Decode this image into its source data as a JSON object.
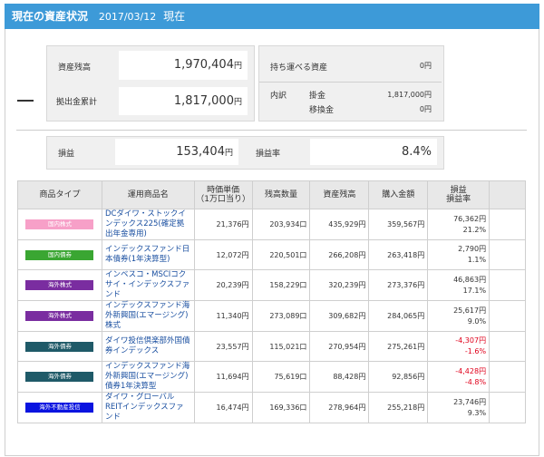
{
  "header": {
    "title": "現在の資産状況",
    "date": "2017/03/12",
    "now": "現在"
  },
  "summary": {
    "asset_label": "資産残高",
    "asset_value": "1,970,404",
    "yen": "円",
    "contrib_label": "拠出金累計",
    "contrib_value": "1,817,000",
    "portable_label": "持ち運べる資産",
    "portable_value": "0円",
    "breakdown_label": "内訳",
    "kakekin_label": "掛金",
    "kakekin_value": "1,817,000円",
    "iko_label": "移換金",
    "iko_value": "0円",
    "dash": "—",
    "profit_label": "損益",
    "profit_value": "153,404",
    "rate_label": "損益率",
    "rate_value": "8.4%"
  },
  "table": {
    "headers": [
      "商品タイプ",
      "運用商品名",
      "時価単価\n（1万口当り）",
      "残高数量",
      "資産残高",
      "購入金額",
      "損益\n損益率"
    ],
    "rows": [
      {
        "type": "国内株式",
        "badge_color": "#f7a0c8",
        "name": "DCダイワ・ストックインデックス225(確定拠出年金専用)",
        "unit_price": "21,376円",
        "qty": "203,934口",
        "balance": "435,929円",
        "purchase": "359,567円",
        "pl": "76,362円",
        "plr": "21.2%",
        "neg": false
      },
      {
        "type": "国内債券",
        "badge_color": "#3aa632",
        "name": "インデックスファンド日本債券(1年決算型)",
        "unit_price": "12,072円",
        "qty": "220,501口",
        "balance": "266,208円",
        "purchase": "263,418円",
        "pl": "2,790円",
        "plr": "1.1%",
        "neg": false
      },
      {
        "type": "海外株式",
        "badge_color": "#7a2da0",
        "name": "インベスコ・MSCIコクサイ・インデックスファンド",
        "unit_price": "20,239円",
        "qty": "158,229口",
        "balance": "320,239円",
        "purchase": "273,376円",
        "pl": "46,863円",
        "plr": "17.1%",
        "neg": false
      },
      {
        "type": "海外株式",
        "badge_color": "#7a2da0",
        "name": "インデックスファンド海外新興国(エマージング)株式",
        "unit_price": "11,340円",
        "qty": "273,089口",
        "balance": "309,682円",
        "purchase": "284,065円",
        "pl": "25,617円",
        "plr": "9.0%",
        "neg": false
      },
      {
        "type": "海外債券",
        "badge_color": "#1f5a68",
        "name": "ダイワ投信倶楽部外国債券インデックス",
        "unit_price": "23,557円",
        "qty": "115,021口",
        "balance": "270,954円",
        "purchase": "275,261円",
        "pl": "-4,307円",
        "plr": "-1.6%",
        "neg": true
      },
      {
        "type": "海外債券",
        "badge_color": "#1f5a68",
        "name": "インデックスファンド海外新興国(エマージング)債券1年決算型",
        "unit_price": "11,694円",
        "qty": "75,619口",
        "balance": "88,428円",
        "purchase": "92,856円",
        "pl": "-4,428円",
        "plr": "-4.8%",
        "neg": true
      },
      {
        "type": "海外不動産投信",
        "badge_color": "#0a14e0",
        "name": "ダイワ・グローバルREITインデックスファンド",
        "unit_price": "16,474円",
        "qty": "169,336口",
        "balance": "278,964円",
        "purchase": "255,218円",
        "pl": "23,746円",
        "plr": "9.3%",
        "neg": false
      }
    ]
  }
}
